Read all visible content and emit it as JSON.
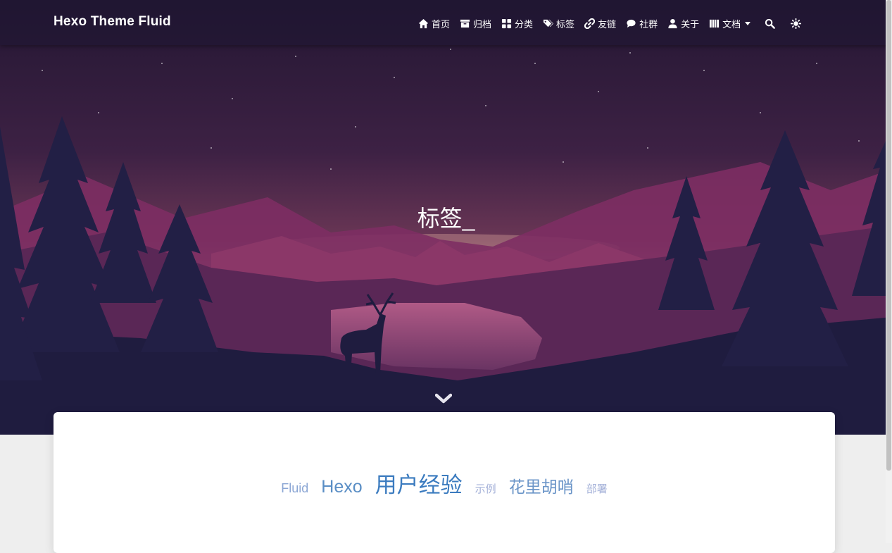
{
  "brand": "Hexo Theme Fluid",
  "nav": {
    "home": "首页",
    "archive": "归档",
    "categories": "分类",
    "tags": "标签",
    "links": "友链",
    "community": "社群",
    "about": "关于",
    "docs": "文档"
  },
  "page_title": "标签_",
  "tags": [
    {
      "label": "Fluid",
      "color": "#8ba6d4",
      "size": 18
    },
    {
      "label": "Hexo",
      "color": "#5a8ec5",
      "size": 25
    },
    {
      "label": "用户经验",
      "color": "#3b7bbf",
      "size": 31
    },
    {
      "label": "示例",
      "color": "#a3b0d8",
      "size": 15
    },
    {
      "label": "花里胡哨",
      "color": "#6b95c8",
      "size": 23
    },
    {
      "label": "部署",
      "color": "#a3b0d8",
      "size": 15
    }
  ],
  "colors": {
    "sky_top": "#2b1b3d",
    "sky_mid": "#5c2f57",
    "horizon_glow": "#a06a78",
    "tree_dark": "#1f1c3f",
    "mountain_pink": "#7a2f62"
  }
}
